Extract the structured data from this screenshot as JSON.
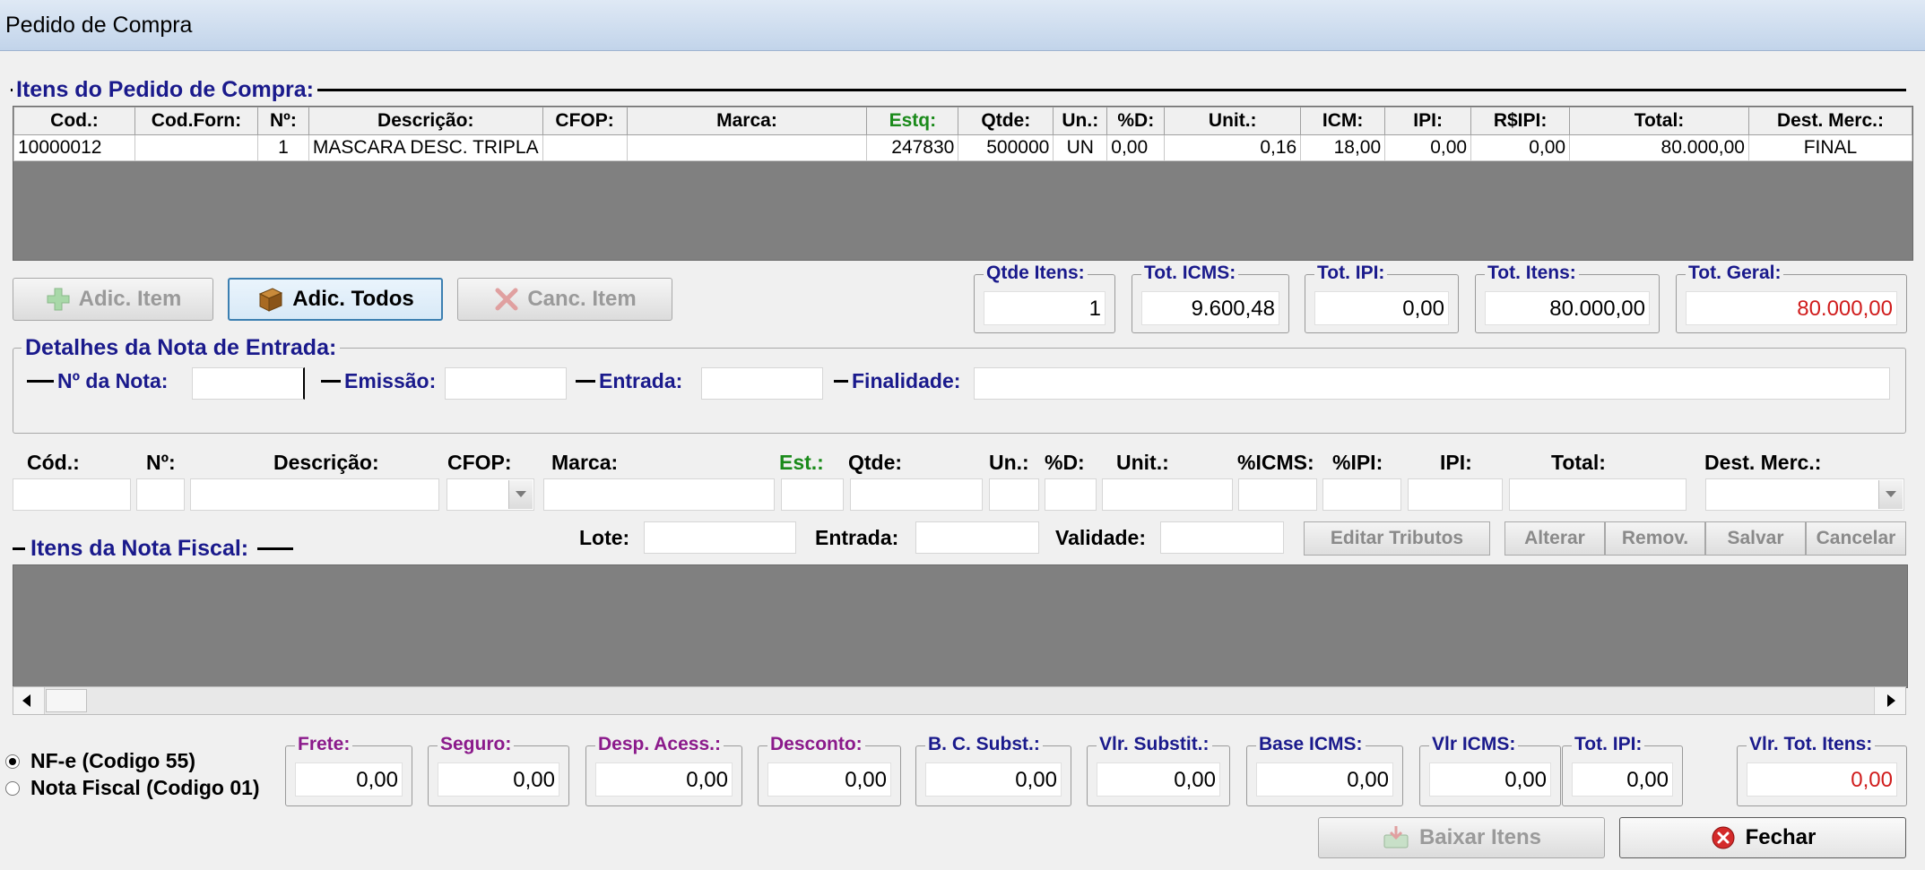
{
  "window": {
    "title": "Pedido de Compra"
  },
  "pedido": {
    "title": "Itens do Pedido de Compra:",
    "columns": [
      "Cod.:",
      "Cod.Forn:",
      "Nº:",
      "Descrição:",
      "CFOP:",
      "Marca:",
      "Estq:",
      "Qtde:",
      "Un.:",
      "%D:",
      "Unit.:",
      "ICM:",
      "IPI:",
      "R$IPI:",
      "Total:",
      "Dest. Merc.:"
    ],
    "rows": [
      [
        "10000012",
        "",
        "1",
        "MASCARA DESC. TRIPLA",
        "",
        "",
        "247830",
        "500000",
        "UN",
        "0,00",
        "0,16",
        "18,00",
        "0,00",
        "0,00",
        "80.000,00",
        "FINAL"
      ]
    ]
  },
  "buttons": {
    "adic_item": "Adic. Item",
    "adic_todos": "Adic. Todos",
    "canc_item": "Canc. Item",
    "editar_tributos": "Editar Tributos",
    "alterar": "Alterar",
    "remov": "Remov.",
    "salvar": "Salvar",
    "cancelar": "Cancelar",
    "baixar_itens": "Baixar Itens",
    "fechar": "Fechar"
  },
  "totals": [
    {
      "label": "Qtde Itens:",
      "value": "1"
    },
    {
      "label": "Tot. ICMS:",
      "value": "9.600,48"
    },
    {
      "label": "Tot. IPI:",
      "value": "0,00"
    },
    {
      "label": "Tot. Itens:",
      "value": "80.000,00"
    },
    {
      "label": "Tot. Geral:",
      "value": "80.000,00"
    }
  ],
  "nota": {
    "title": "Detalhes da Nota de Entrada:",
    "numero_label": "Nº da Nota:",
    "emissao_label": "Emissão:",
    "entrada_label": "Entrada:",
    "finalidade_label": "Finalidade:"
  },
  "entry": {
    "labels": [
      "Cód.:",
      "Nº:",
      "Descrição:",
      "CFOP:",
      "Marca:",
      "Est.:",
      "Qtde:",
      "Un.:",
      "%D:",
      "Unit.:",
      "%ICMS:",
      "%IPI:",
      "IPI:",
      "Total:",
      "Dest. Merc.:"
    ],
    "lote_label": "Lote:",
    "entrada_label": "Entrada:",
    "validade_label": "Validade:"
  },
  "itens_nf": {
    "title": "Itens da Nota Fiscal:"
  },
  "radios": [
    {
      "label": "NF-e (Codigo 55)",
      "checked": true
    },
    {
      "label": "Nota Fiscal (Codigo 01)",
      "checked": false
    }
  ],
  "bottom_totals": [
    {
      "label": "Frete:",
      "value": "0,00"
    },
    {
      "label": "Seguro:",
      "value": "0,00"
    },
    {
      "label": "Desp. Acess.:",
      "value": "0,00"
    },
    {
      "label": "Desconto:",
      "value": "0,00"
    },
    {
      "label": "B. C. Subst.:",
      "value": "0,00"
    },
    {
      "label": "Vlr. Substit.:",
      "value": "0,00"
    },
    {
      "label": "Base ICMS:",
      "value": "0,00"
    },
    {
      "label": "Vlr ICMS:",
      "value": "0,00"
    },
    {
      "label": "Tot. IPI:",
      "value": "0,00"
    },
    {
      "label": "Vlr. Tot. Itens:",
      "value": "0,00"
    }
  ],
  "colors": {
    "label_blue": "#1a1a8c",
    "label_purple": "#8b1a8b",
    "total_red": "#d01c1c",
    "estq_green": "#1a8a1a"
  }
}
